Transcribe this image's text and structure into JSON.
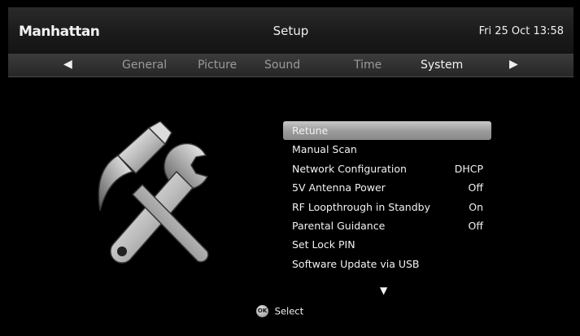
{
  "header": {
    "brand": "Manhattan",
    "title": "Setup",
    "datetime": "Fri 25 Oct 13:58"
  },
  "tabs": {
    "prev_icon": "left-triangle-icon",
    "next_icon": "right-triangle-icon",
    "items": [
      {
        "label": "General",
        "active": false
      },
      {
        "label": "Picture",
        "active": false
      },
      {
        "label": "Sound",
        "active": false
      },
      {
        "label": "Time",
        "active": false
      },
      {
        "label": "System",
        "active": true
      }
    ]
  },
  "graphic": {
    "icon": "hammer-wrench-icon"
  },
  "menu": {
    "items": [
      {
        "label": "Retune",
        "value": "",
        "selected": true
      },
      {
        "label": "Manual Scan",
        "value": ""
      },
      {
        "label": "Network Configuration",
        "value": "DHCP"
      },
      {
        "label": "5V Antenna Power",
        "value": "Off"
      },
      {
        "label": "RF Loopthrough in Standby",
        "value": "On"
      },
      {
        "label": "Parental Guidance",
        "value": "Off"
      },
      {
        "label": "Set Lock PIN",
        "value": ""
      },
      {
        "label": "Software Update via USB",
        "value": ""
      }
    ],
    "scroll_icon": "down-triangle-icon"
  },
  "footer": {
    "ok_badge": "OK",
    "action_label": "Select"
  },
  "colors": {
    "background": "#000000",
    "highlight": "#a8a8a8",
    "text": "#f2f2f2",
    "inactive_tab": "#9a9a9a"
  }
}
